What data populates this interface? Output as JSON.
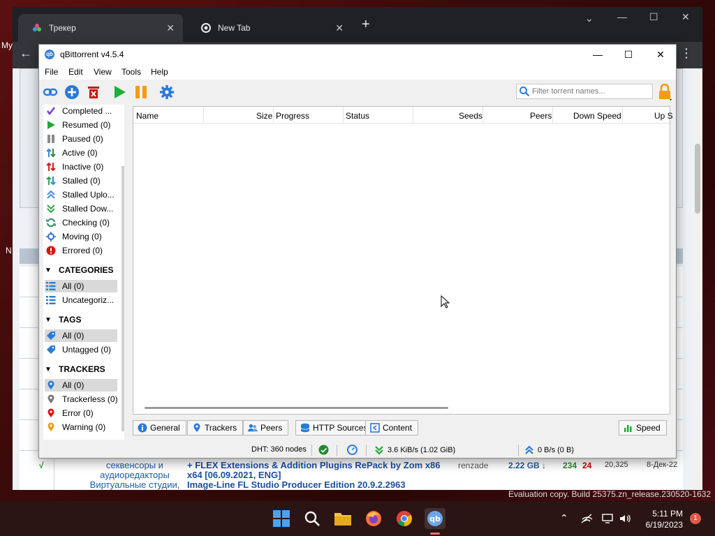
{
  "browser": {
    "tabs": [
      {
        "title": "Трекер"
      },
      {
        "title": "New Tab"
      }
    ],
    "desktop_labels": [
      "My",
      "N"
    ]
  },
  "webpage_row": {
    "category_line1": "секвенсоры и",
    "category_line2": "аудиоредакторы",
    "title": "+ FLEX Extensions & Addition Plugins RePack by Zom x86 x64 [06.09.2021, ENG]",
    "next_category": "Виртуальные студии,",
    "next_title": "Image-Line FL Studio Producer Edition 20.9.2.2963",
    "author": "renzade",
    "size": "2.22 GB ↓",
    "seeds": "234",
    "leech": "24",
    "downloads": "20,325",
    "date": "8-Дек-22",
    "marker": "√"
  },
  "qb": {
    "title": "qBittorrent v4.5.4",
    "logo_text": "qb",
    "menu": [
      "File",
      "Edit",
      "View",
      "Tools",
      "Help"
    ],
    "filter_placeholder": "Filter torrent names...",
    "status_items": [
      {
        "label": "Completed ...",
        "icon": "completed-icon",
        "color": "#7a3fd1"
      },
      {
        "label": "Resumed (0)",
        "icon": "resume-icon",
        "color": "#22a83a"
      },
      {
        "label": "Paused (0)",
        "icon": "pause-icon",
        "color": "#8a8a8a"
      },
      {
        "label": "Active (0)",
        "icon": "active-icon",
        "color": "#2f8a3a"
      },
      {
        "label": "Inactive (0)",
        "icon": "inactive-icon",
        "color": "#d02020"
      },
      {
        "label": "Stalled (0)",
        "icon": "stalled-icon",
        "color": "#2f8ad0"
      },
      {
        "label": "Stalled Uplo...",
        "icon": "stalled-upload-icon",
        "color": "#4a8ad8"
      },
      {
        "label": "Stalled Dow...",
        "icon": "stalled-download-icon",
        "color": "#2fa84a"
      },
      {
        "label": "Checking (0)",
        "icon": "checking-icon",
        "color": "#2f8a5a"
      },
      {
        "label": "Moving (0)",
        "icon": "moving-icon",
        "color": "#2f6ad0"
      },
      {
        "label": "Errored (0)",
        "icon": "error-icon",
        "color": "#e01010"
      }
    ],
    "categories": {
      "heading": "CATEGORIES",
      "items": [
        "All (0)",
        "Uncategoriz..."
      ]
    },
    "tags": {
      "heading": "TAGS",
      "items": [
        "All (0)",
        "Untagged (0)"
      ]
    },
    "trackers": {
      "heading": "TRACKERS",
      "items": [
        "All (0)",
        "Trackerless (0)",
        "Error (0)",
        "Warning (0)"
      ]
    },
    "columns": [
      "Name",
      "Size",
      "Progress",
      "Status",
      "Seeds",
      "Peers",
      "Down Speed",
      "Up S"
    ],
    "bottom_tabs": [
      "General",
      "Trackers",
      "Peers",
      "HTTP Sources",
      "Content"
    ],
    "speed_tab": "Speed",
    "status": {
      "dht": "DHT: 360 nodes",
      "down": "3.6 KiB/s (1.02 GiB)",
      "up": "0 B/s (0 B)"
    }
  },
  "taskbar": {
    "evaluation": "Evaluation copy. Build 25375.zn_release.230520-1632",
    "time": "5:11 PM",
    "date": "6/19/2023",
    "notifications": "1"
  }
}
